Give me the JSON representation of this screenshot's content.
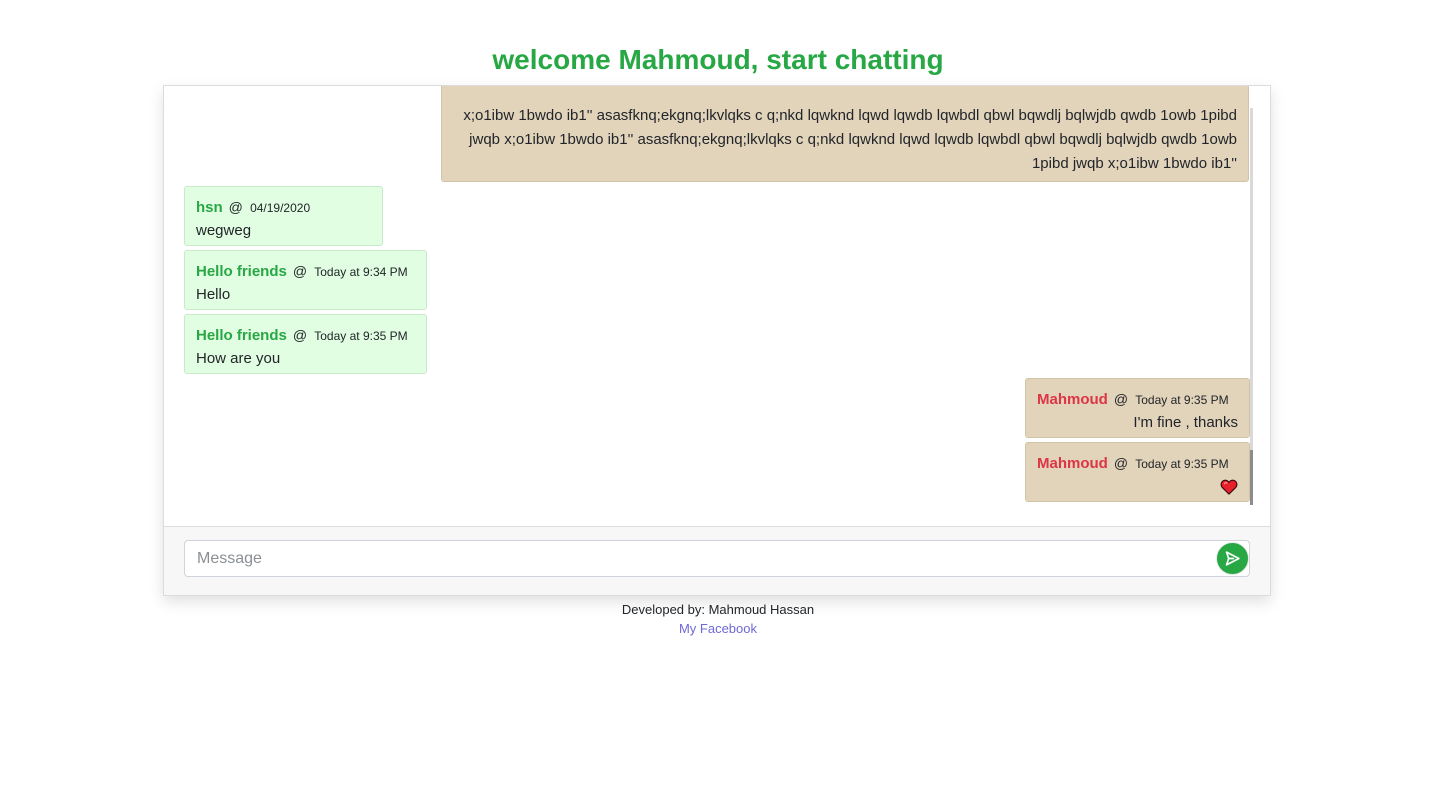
{
  "page": {
    "title": "welcome Mahmoud, start chatting"
  },
  "messages": [
    {
      "sender": "",
      "time": "",
      "text": "x;o1ibw 1bwdo ib1'' asasfknq;ekgnq;lkvlqks c q;nkd lqwknd lqwd lqwdb lqwbdl qbwl bqwdlj bqlwjdb qwdb 1owb 1pibd jwqb x;o1ibw 1bwdo ib1'' asasfknq;ekgnq;lkvlqks c q;nkd lqwknd lqwd lqwdb lqwbdl qbwl bqwdlj bqlwjdb qwdb 1owb 1pibd jwqb x;o1ibw 1bwdo ib1''",
      "mine": true
    },
    {
      "sender": "hsn",
      "at": "@",
      "time": "04/19/2020",
      "text": "wegweg",
      "mine": false
    },
    {
      "sender": "Hello friends",
      "at": "@",
      "time": "Today at 9:34 PM",
      "text": "Hello",
      "mine": false
    },
    {
      "sender": "Hello friends",
      "at": "@",
      "time": "Today at 9:35 PM",
      "text": "How are you",
      "mine": false
    },
    {
      "sender": "Mahmoud",
      "at": "@",
      "time": "Today at 9:35 PM",
      "text": "I'm fine , thanks",
      "mine": true
    },
    {
      "sender": "Mahmoud",
      "at": "@",
      "time": "Today at 9:35 PM",
      "icon": "heart-icon",
      "mine": true
    }
  ],
  "composer": {
    "placeholder": "Message",
    "send_icon": "send-icon"
  },
  "footer": {
    "developed_by": "Developed by: Mahmoud Hassan",
    "link_text": "My Facebook"
  },
  "colors": {
    "accent": "#28a745",
    "own_message_bg": "#e2d3bb",
    "other_message_bg": "#e2fee2",
    "own_sender": "#dc3545",
    "link": "#6f69d6"
  }
}
